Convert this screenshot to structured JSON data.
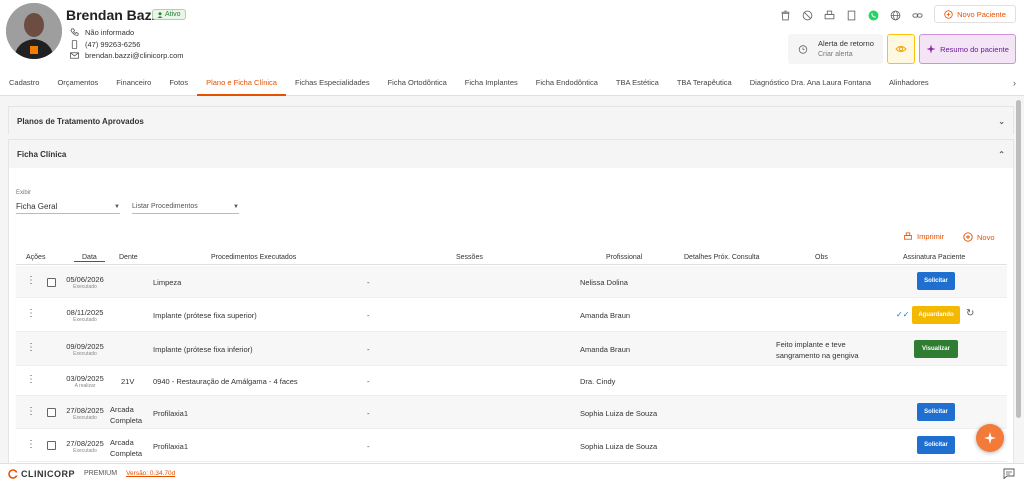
{
  "patient": {
    "name": "Brendan Bazzi",
    "status": "Ativo",
    "contact_info": "Não informado",
    "phone": "(47) 99263-6256",
    "email": "brendan.bazzi@clinicorp.com"
  },
  "header": {
    "new_patient": "Novo Paciente",
    "alert_title": "Alerta de retorno",
    "alert_sub": "Criar alerta",
    "summary": "Resumo do paciente",
    "icons": [
      "trash-icon",
      "block-icon",
      "print-icon",
      "phone-icon",
      "whatsapp-icon",
      "globe-icon",
      "link-icon"
    ]
  },
  "tabs": [
    "Cadastro",
    "Orçamentos",
    "Financeiro",
    "Fotos",
    "Plano e Ficha Clínica",
    "Fichas Especialidades",
    "Ficha Ortodôntica",
    "Ficha Implantes",
    "Ficha Endodôntica",
    "TBA Estética",
    "TBA Terapêutica",
    "Diagnóstico Dra. Ana Laura Fontana",
    "Alinhadores"
  ],
  "active_tab": "Plano e Ficha Clínica",
  "panels": {
    "approved": "Planos de Tratamento Aprovados",
    "clinical": "Ficha Clínica"
  },
  "filters": {
    "exibir_label": "Exibir",
    "exibir_value": "Ficha Geral",
    "listar": "Listar Procedimentos"
  },
  "actions": {
    "print": "Imprimir",
    "new": "Novo"
  },
  "columns": [
    "Ações",
    "Data",
    "Dente",
    "Procedimentos Executados",
    "Sessões",
    "Profissional",
    "Detalhes Próx. Consulta",
    "Obs",
    "Assinatura Paciente"
  ],
  "rows": [
    {
      "date": "05/06/2026",
      "status": "Executado",
      "tooth": "",
      "procedure": "Limpeza",
      "sessions": "-",
      "professional": "Nelissa Dolina",
      "obs": "",
      "button": "Solicitar"
    },
    {
      "date": "08/11/2025",
      "status": "Executado",
      "tooth": "",
      "procedure": "Implante (prótese fixa superior)",
      "sessions": "-",
      "professional": "Amanda Braun",
      "obs": "",
      "button": "Aguardando"
    },
    {
      "date": "09/09/2025",
      "status": "Executado",
      "tooth": "",
      "procedure": "Implante (prótese fixa inferior)",
      "sessions": "-",
      "professional": "Amanda Braun",
      "obs": "Feito implante e teve sangramento na gengiva",
      "button": "Visualizar"
    },
    {
      "date": "03/09/2025",
      "status": "A realizar",
      "tooth": "21V",
      "procedure": "0940 - Restauração de Amálgama - 4 faces",
      "sessions": "-",
      "professional": "Dra. Cindy",
      "obs": "",
      "button": ""
    },
    {
      "date": "27/08/2025",
      "status": "Executado",
      "tooth": "Arcada Completa",
      "procedure": "Profilaxia1",
      "sessions": "-",
      "professional": "Sophia Luiza de Souza",
      "obs": "",
      "button": "Solicitar"
    },
    {
      "date": "27/08/2025",
      "status": "Executado",
      "tooth": "Arcada Completa",
      "procedure": "Profilaxia1",
      "sessions": "-",
      "professional": "Sophia Luiza de Souza",
      "obs": "",
      "button": "Solicitar"
    }
  ],
  "footer": {
    "brand": "CLINICORP",
    "plan": "PREMIUM",
    "version": "Versão: 0.34.70d"
  },
  "colors": {
    "accent": "#e65100",
    "blue_button": "#1e6fcf",
    "yellow_button": "#f5b800",
    "green_button": "#2e7d32"
  }
}
